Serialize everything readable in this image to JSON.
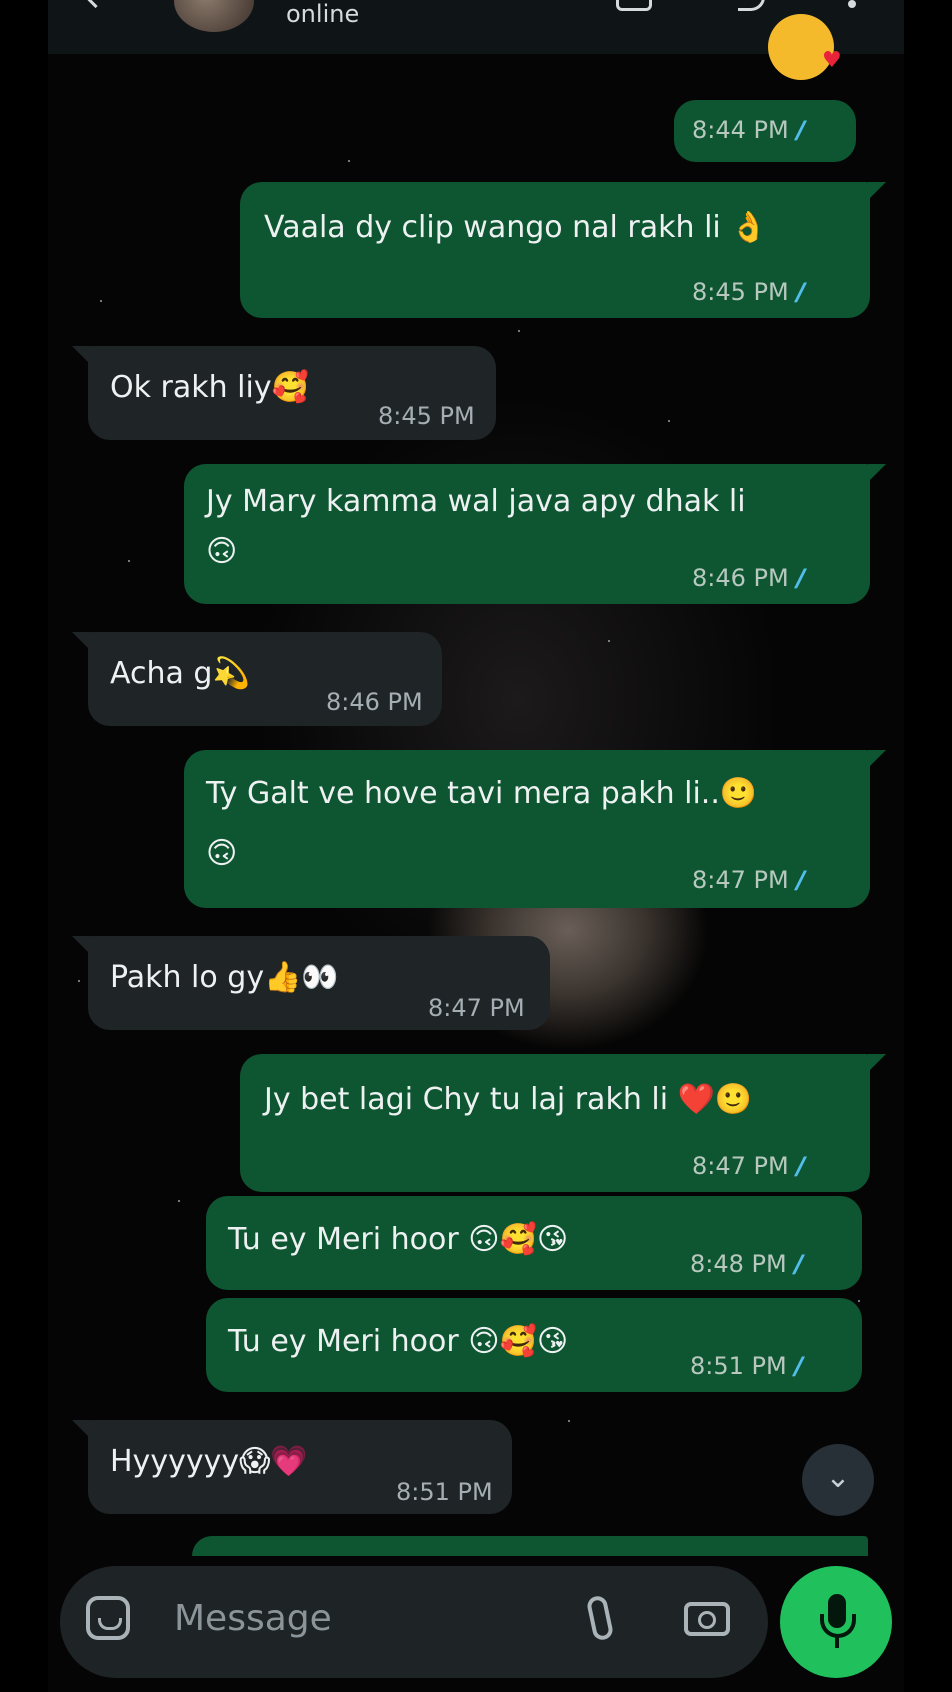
{
  "header": {
    "status": "online"
  },
  "messages": [
    {
      "id": "m0",
      "dir": "out",
      "text": "",
      "time": "8:44 PM"
    },
    {
      "id": "m1",
      "dir": "out",
      "text": "Vaala dy clip wango nal rakh li 👌",
      "time": "8:45 PM"
    },
    {
      "id": "m2",
      "dir": "in",
      "text": "Ok rakh liy🥰",
      "time": "8:45 PM"
    },
    {
      "id": "m3",
      "dir": "out",
      "text": "Jy Mary kamma wal java apy dhak li",
      "text2": "🙃",
      "time": "8:46 PM"
    },
    {
      "id": "m4",
      "dir": "in",
      "text": "Acha g💫",
      "time": "8:46 PM"
    },
    {
      "id": "m5",
      "dir": "out",
      "text": "Ty Galt ve hove tavi mera pakh li..🙂",
      "text2": "🙃",
      "time": "8:47 PM"
    },
    {
      "id": "m6",
      "dir": "in",
      "text": "Pakh lo gy👍👀",
      "time": "8:47 PM"
    },
    {
      "id": "m7",
      "dir": "out",
      "text": "Jy bet lagi Chy tu laj rakh li ❤️🙂",
      "time": "8:47 PM"
    },
    {
      "id": "m8",
      "dir": "out",
      "text": "Tu ey Meri hoor 🙃🥰😘",
      "time": "8:48 PM"
    },
    {
      "id": "m9",
      "dir": "out",
      "text": "Tu ey Meri hoor 🙃🥰😘",
      "time": "8:51 PM"
    },
    {
      "id": "m10",
      "dir": "in",
      "text": "Hyyyyyy😱💗",
      "time": "8:51 PM"
    }
  ],
  "composer": {
    "placeholder": "Message"
  },
  "colors": {
    "outgoing_bubble": "#0d5631",
    "incoming_bubble": "#1f2426",
    "read_ticks": "#53bdeb",
    "mic_button": "#20c05c"
  },
  "icons": [
    "back-icon",
    "video-call-icon",
    "voice-call-icon",
    "more-icon",
    "sticker-icon",
    "attach-icon",
    "camera-icon",
    "mic-icon",
    "scroll-down-icon"
  ]
}
